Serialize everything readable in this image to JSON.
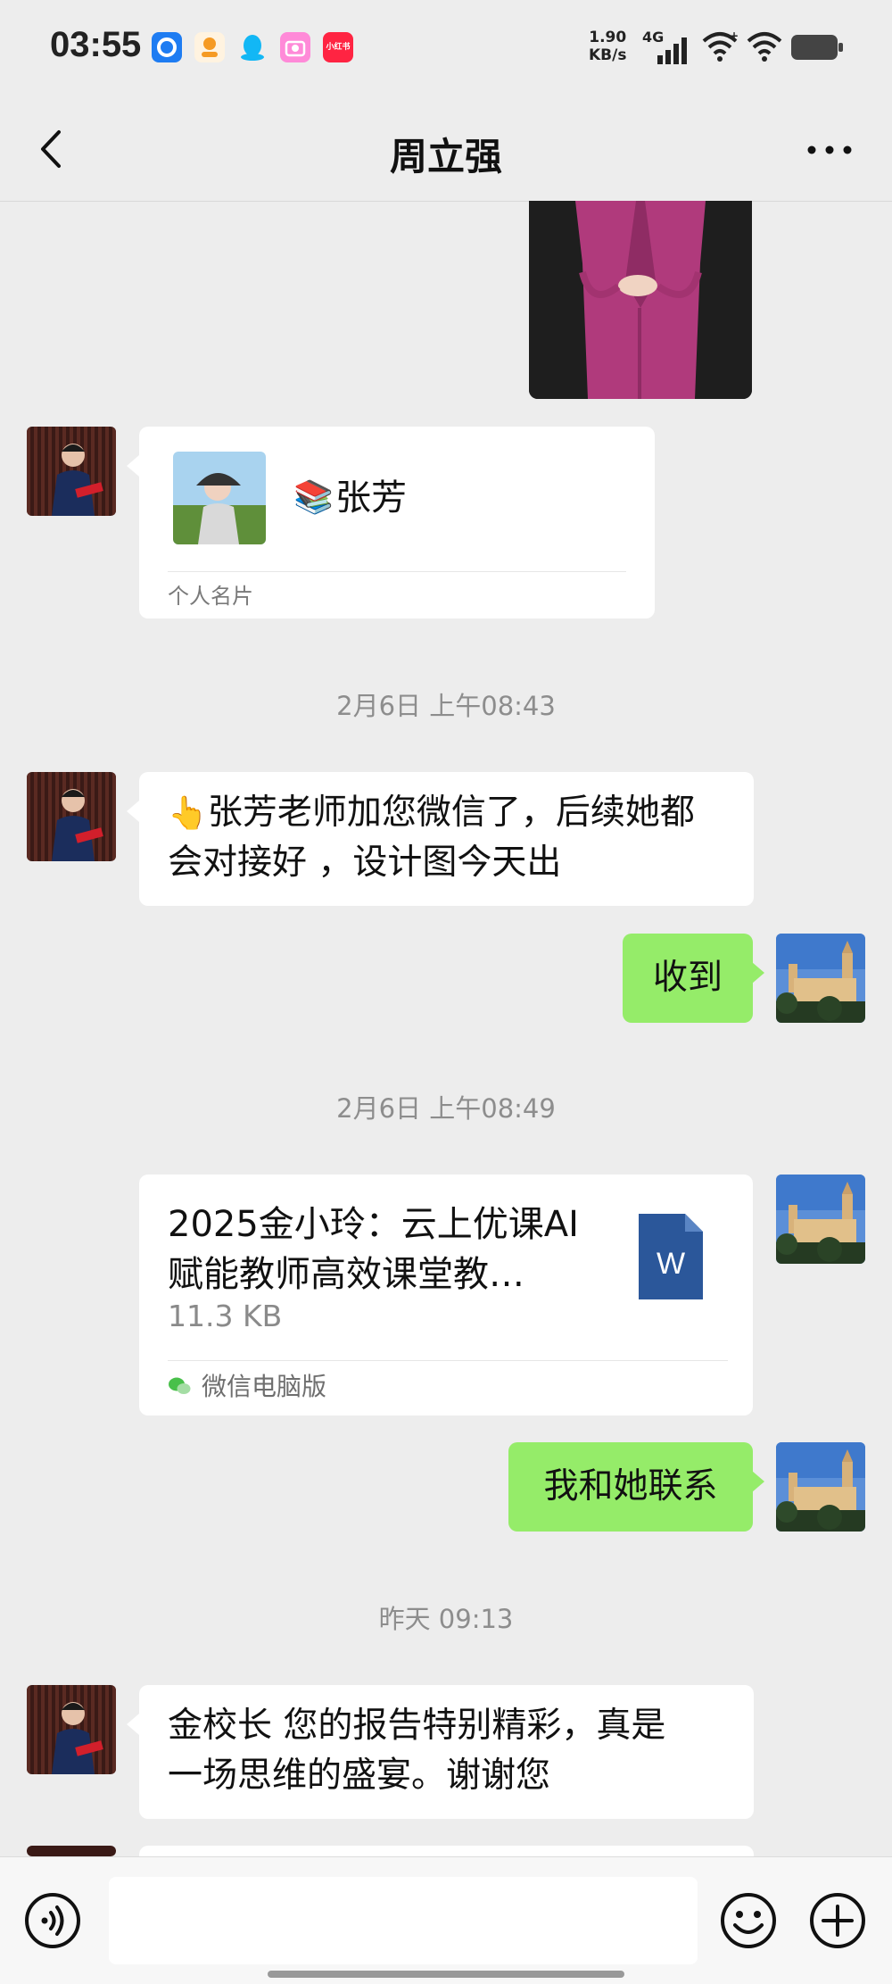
{
  "status_bar": {
    "time": "03:55",
    "net_speed_value": "1.90",
    "net_speed_unit": "KB/s",
    "network": "4G",
    "app_badge_text": "小红书",
    "icons": [
      "app-blue-icon",
      "app-orange-icon",
      "qq-icon",
      "camera-icon",
      "xiaohongshu-icon",
      "signal-icon",
      "wifi-icon",
      "wifi-icon",
      "battery-icon"
    ]
  },
  "header": {
    "title": "周立强",
    "back_icon": "chevron-left-icon",
    "more_icon": "more-dots-icon"
  },
  "messages": {
    "card": {
      "name": "张芳",
      "emoji": "📚",
      "type_label": "个人名片"
    },
    "ts1": "2月6日 上午08:43",
    "msg1_emoji": "👆",
    "msg1_line1": "张芳老师加您微信了，后续她都",
    "msg1_line2": "会对接好 ，设计图今天出",
    "reply1": "收到",
    "ts2": "2月6日 上午08:49",
    "file": {
      "name_line1": "2025金小玲：云上优课AI",
      "name_line2": "赋能教师高效课堂教…",
      "size": "11.3 KB",
      "icon_letter": "W",
      "source": "微信电脑版"
    },
    "reply2": "我和她联系",
    "ts3": "昨天 09:13",
    "msg3_line1": "金校长 您的报告特别精彩，真是",
    "msg3_line2": "一场思维的盛宴。谢谢您"
  },
  "input_bar": {
    "icons": [
      "voice-icon",
      "emoji-icon",
      "plus-icon"
    ],
    "placeholder": ""
  },
  "colors": {
    "background": "#ededed",
    "sent_bubble": "#95ec69",
    "received_bubble": "#ffffff",
    "word_icon": "#2b579a"
  }
}
